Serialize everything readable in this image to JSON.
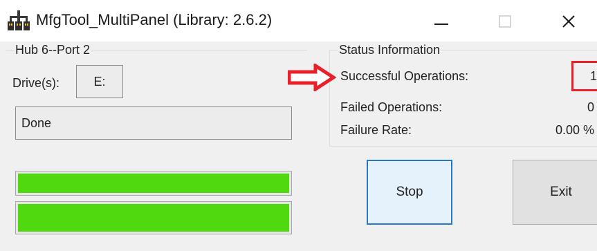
{
  "window": {
    "title": "MfgTool_MultiPanel (Library: 2.6.2)",
    "icons": {
      "app": "usb-hub-icon",
      "minimize": "minimize-icon",
      "maximize": "maximize-icon",
      "close": "close-icon"
    }
  },
  "hub_panel": {
    "group_title": "Hub 6--Port 2",
    "drive_label": "Drive(s):",
    "drive_value": "E:",
    "status_text": "Done",
    "progress_bars": [
      {
        "percent": 100
      },
      {
        "percent": 100
      }
    ]
  },
  "status_info": {
    "group_title": "Status Information",
    "rows": [
      {
        "label": "Successful Operations:",
        "value": "1"
      },
      {
        "label": "Failed Operations:",
        "value": "0"
      },
      {
        "label": "Failure Rate:",
        "value": "0.00 %"
      }
    ]
  },
  "buttons": {
    "stop_label": "Stop",
    "exit_label": "Exit"
  },
  "annotations": {
    "arrow_icon": "red-arrow-right-icon",
    "highlight_color": "#e8202a"
  },
  "colors": {
    "progress_fill": "#4fd90e",
    "focus_border": "#2a76c9"
  }
}
